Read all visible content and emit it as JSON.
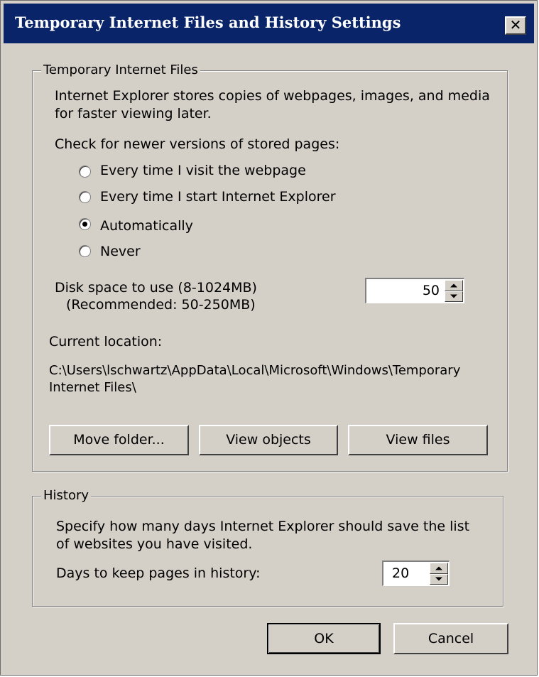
{
  "window": {
    "title": "Temporary Internet Files and History Settings",
    "close_glyph": "✕"
  },
  "tif": {
    "legend": "Temporary Internet Files",
    "desc_line1": "Internet Explorer stores copies of webpages, images, and media",
    "desc_line2": "for faster viewing later.",
    "check_label": "Check for newer versions of stored pages:",
    "options": [
      {
        "label": "Every time I visit the webpage",
        "checked": false
      },
      {
        "label": "Every time I start Internet Explorer",
        "checked": false
      },
      {
        "label": "Automatically",
        "checked": true
      },
      {
        "label": "Never",
        "checked": false
      }
    ],
    "disk_label1": "Disk space to use (8-1024MB)",
    "disk_label2": "(Recommended: 50-250MB)",
    "disk_value": "50",
    "current_location_label": "Current location:",
    "path_line1": "C:\\Users\\lschwartz\\AppData\\Local\\Microsoft\\Windows\\Temporary",
    "path_line2": "Internet Files\\",
    "buttons": {
      "move": "Move folder...",
      "objects": "View objects",
      "files": "View files"
    }
  },
  "history": {
    "legend": "History",
    "desc_line1": "Specify how many days Internet Explorer should save the list",
    "desc_line2": "of websites you have visited.",
    "days_label": "Days to keep pages in history:",
    "days_value": "20"
  },
  "footer": {
    "ok": "OK",
    "cancel": "Cancel"
  }
}
